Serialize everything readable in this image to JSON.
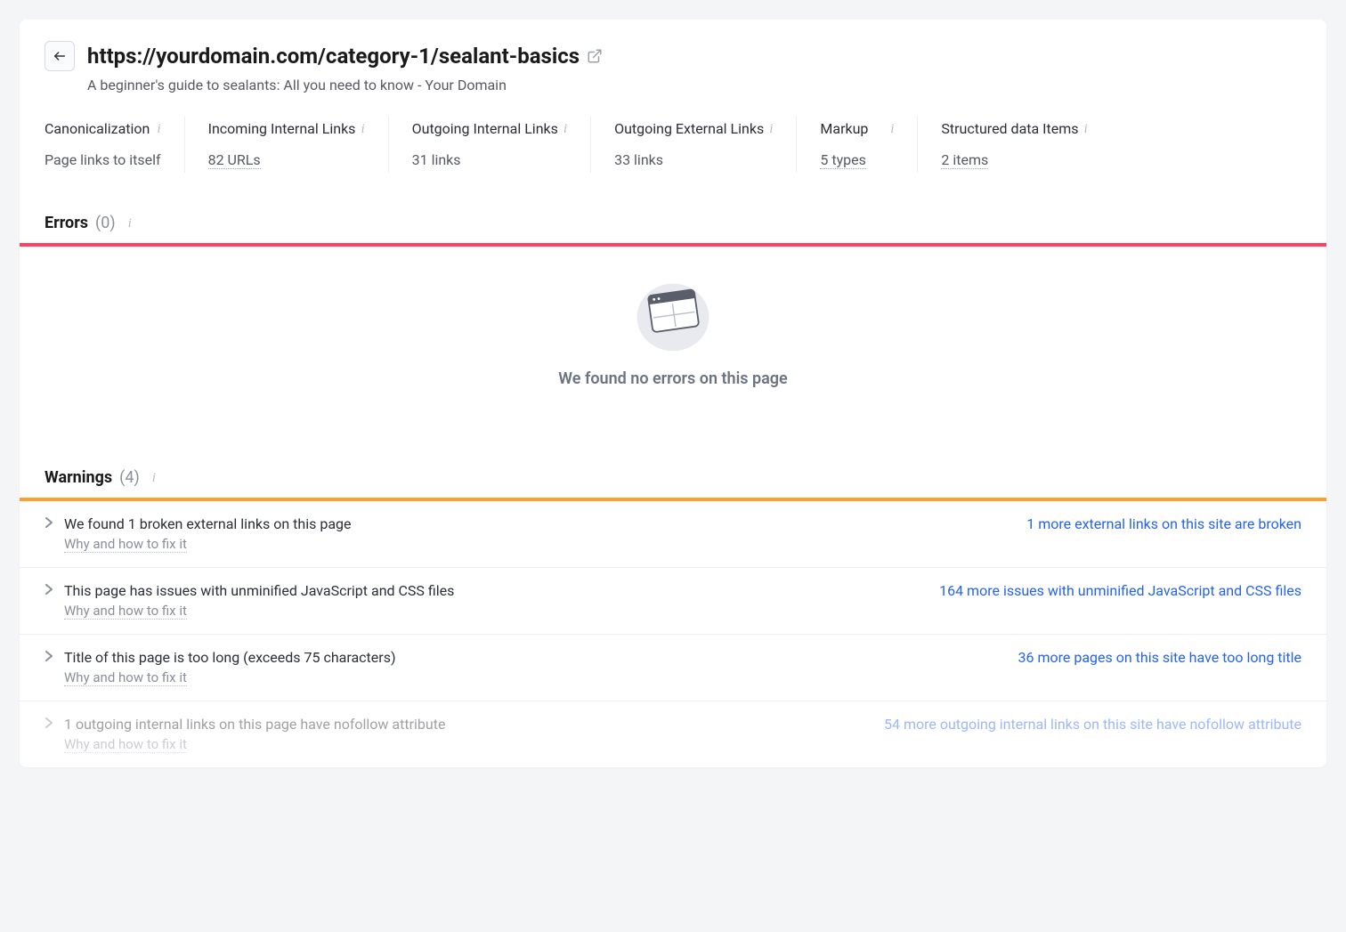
{
  "header": {
    "url": "https://yourdomain.com/category-1/sealant-basics",
    "subtitle": "A beginner's guide to sealants: All you need to know - Your Domain"
  },
  "stats": [
    {
      "label": "Canonicalization",
      "value": "Page links to itself",
      "link": false,
      "info": true
    },
    {
      "label": "Incoming Internal Links",
      "value": "82 URLs",
      "link": true,
      "info": true
    },
    {
      "label": "Outgoing Internal Links",
      "value": "31 links",
      "link": false,
      "info": true
    },
    {
      "label": "Outgoing External Links",
      "value": "33 links",
      "link": false,
      "info": true
    },
    {
      "label": "Markup",
      "value": "5 types",
      "link": true,
      "info": true
    },
    {
      "label": "Structured data Items",
      "value": "2 items",
      "link": true,
      "info": true
    }
  ],
  "errors": {
    "title": "Errors",
    "count": "(0)",
    "empty_text": "We found no errors on this page"
  },
  "warnings": {
    "title": "Warnings",
    "count": "(4)",
    "hint": "Why and how to fix it",
    "items": [
      {
        "title": "We found 1 broken external links on this page",
        "related": "1 more external links on this site are broken"
      },
      {
        "title": "This page has issues with unminified JavaScript and CSS files",
        "related": "164 more issues with unminified JavaScript and CSS files"
      },
      {
        "title": "Title of this page is too long (exceeds 75 characters)",
        "related": "36 more pages on this site have too long title"
      },
      {
        "title": "1 outgoing internal links on this page have nofollow attribute",
        "related": "54 more outgoing internal links on this site have nofollow attribute"
      }
    ]
  }
}
